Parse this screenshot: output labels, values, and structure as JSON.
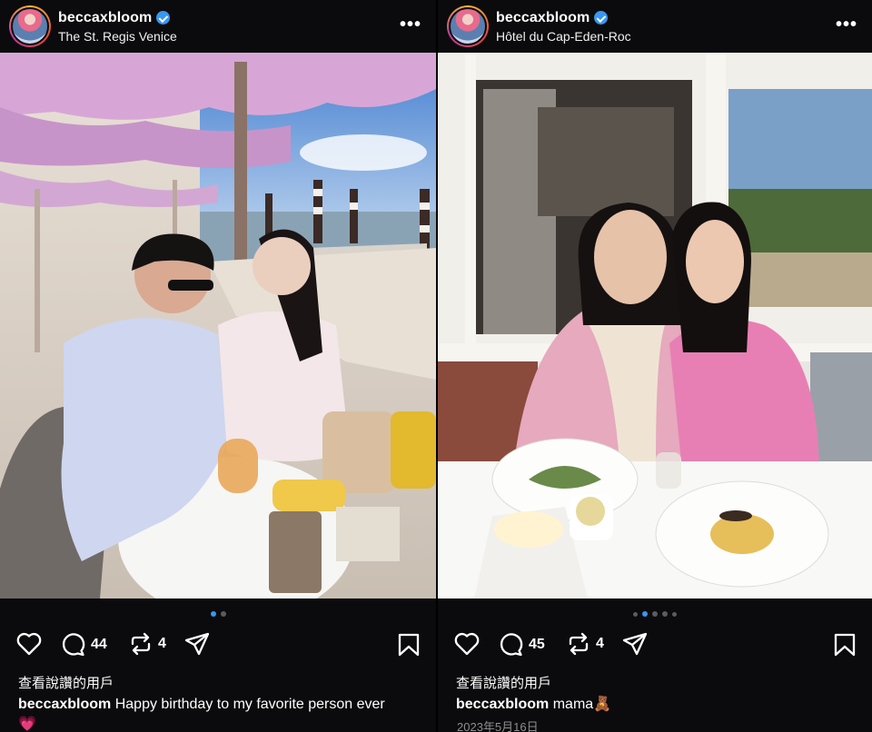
{
  "posts": [
    {
      "username": "beccaxbloom",
      "location": "The St. Regis Venice",
      "more_icon": "more-horizontal-icon",
      "carousel": {
        "count": 2,
        "active": 0
      },
      "comments": "44",
      "reposts": "4",
      "viewers_label": "查看說讚的用戶",
      "caption_user": "beccaxbloom",
      "caption_text": " Happy birthday to my favorite person ever💗"
    },
    {
      "username": "beccaxbloom",
      "location": "Hôtel du Cap-Eden-Roc",
      "more_icon": "more-horizontal-icon",
      "carousel": {
        "count": 5,
        "active": 1
      },
      "comments": "45",
      "reposts": "4",
      "viewers_label": "查看說讚的用戶",
      "caption_user": "beccaxbloom",
      "caption_text": " mama🧸",
      "date": "2023年5月16日"
    }
  ],
  "colors": {
    "background": "#0b0b0d",
    "verified": "#3897f0",
    "active_dot": "#3897f0",
    "date": "#8e8e8e"
  }
}
